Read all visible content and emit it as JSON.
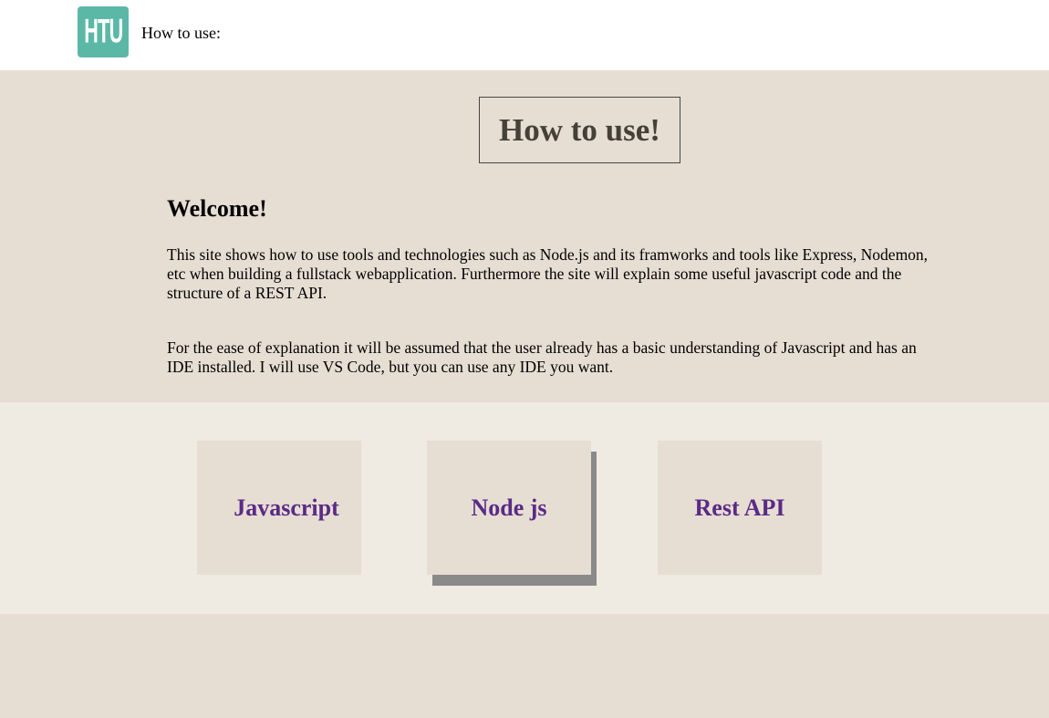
{
  "header": {
    "logo_text": "HTU",
    "title": "How to use:"
  },
  "intro": {
    "page_title": "How to use!",
    "welcome_heading": "Welcome!",
    "paragraph_1": "This site shows how to use tools and technologies such as Node.js and its framworks and tools like Express, Nodemon, etc when building a fullstack webapplication. Furthermore the site will explain some useful javascript code and the structure of a REST API.",
    "paragraph_2": "For the ease of explanation it will be assumed that the user already has a basic understanding of Javascript and has an IDE installed. I will use VS Code, but you can use any IDE you want."
  },
  "cards": [
    {
      "label": "Javascript"
    },
    {
      "label": "Node js"
    },
    {
      "label": "Rest API"
    }
  ],
  "colors": {
    "logo_bg": "#5cb8a6",
    "page_bg": "#e6ded3",
    "cards_bg": "#f0ebe2",
    "link": "#5b2a86",
    "shadow": "#8a8a8a"
  }
}
